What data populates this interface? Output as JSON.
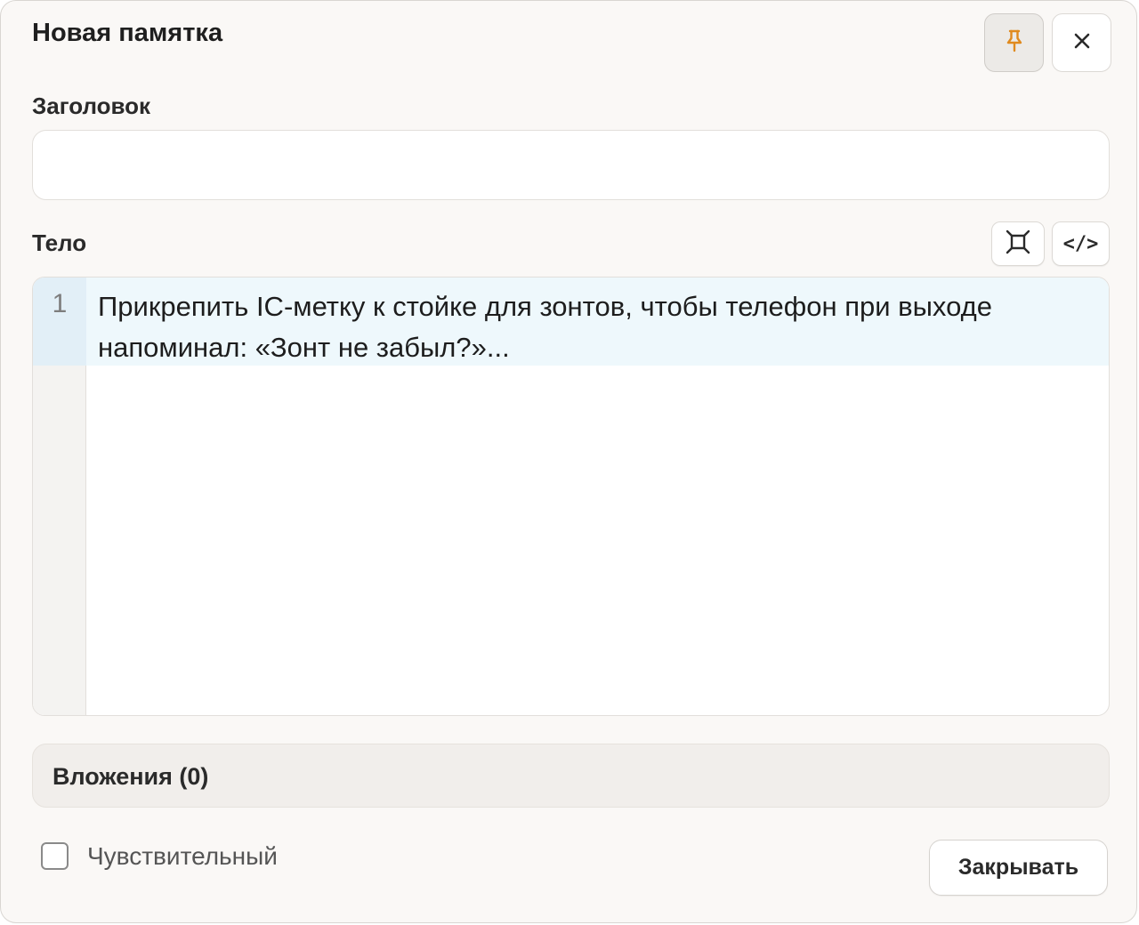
{
  "dialog": {
    "title": "Новая памятка"
  },
  "header": {
    "pin_icon": "pin-icon",
    "close_icon": "close-icon",
    "close_glyph": "✕",
    "accent_color": "#e08a1e"
  },
  "fields": {
    "title_label": "Заголовок",
    "title_value": "",
    "body_label": "Тело"
  },
  "toolbar": {
    "expand_icon": "expand-icon",
    "code_label": "</>"
  },
  "editor": {
    "lines": [
      {
        "number": "1",
        "text": "Прикрепить IC-метку к стойке для зонтов, чтобы телефон при выходе напоминал: «Зонт не забыл?»..."
      }
    ]
  },
  "attachments": {
    "label": "Вложения (0)"
  },
  "footer": {
    "sensitive_label": "Чувствительный",
    "sensitive_checked": false,
    "close_button_label": "Закрывать"
  }
}
